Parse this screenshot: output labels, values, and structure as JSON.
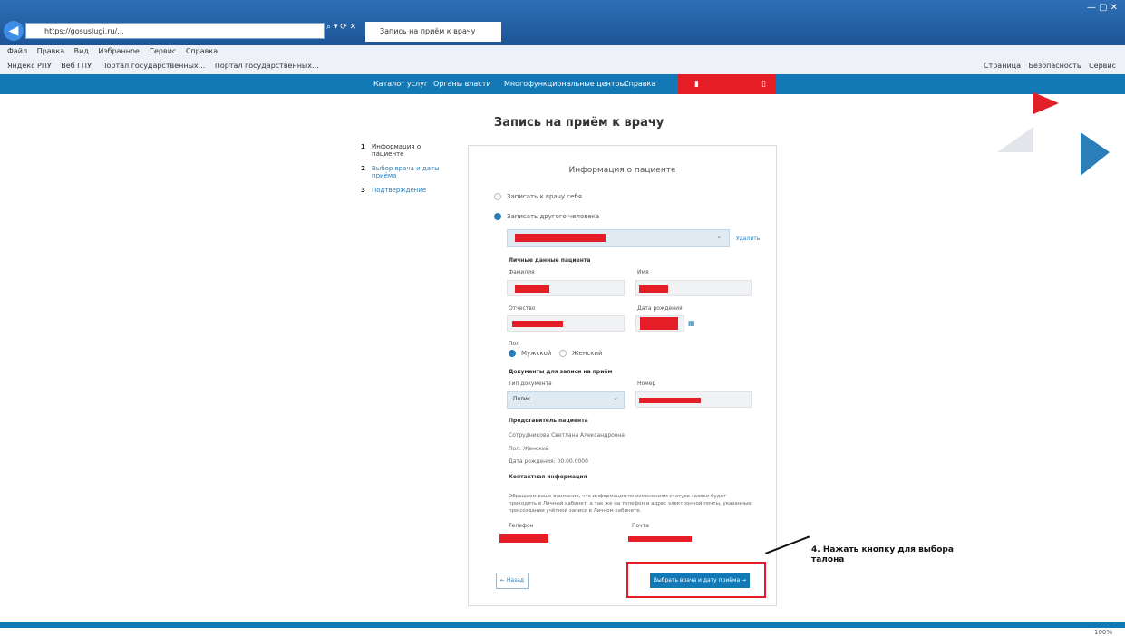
{
  "browser": {
    "address": "https://gosuslugi.ru/...",
    "tab_title": "Запись на приём к врачу",
    "menu": [
      "Файл",
      "Правка",
      "Вид",
      "Избранное",
      "Сервис",
      "Справка"
    ],
    "favorites": [
      "Яндекс РПУ",
      "Веб ГПУ",
      "Портал государственных...",
      "Портал государственных..."
    ],
    "toolbar_right": [
      "Страница",
      "Безопасность",
      "Сервис"
    ],
    "zoom": "100%"
  },
  "site_nav": {
    "items": [
      "Каталог услуг",
      "Органы власти",
      "Многофункциональные центры",
      "Справка"
    ]
  },
  "page": {
    "title": "Запись на приём к врачу"
  },
  "steps": [
    {
      "num": "1",
      "label": "Информация о пациенте"
    },
    {
      "num": "2",
      "label": "Выбор врача и даты приёма"
    },
    {
      "num": "3",
      "label": "Подтверждение"
    }
  ],
  "form": {
    "title": "Информация о пациенте",
    "option_self": "Записать к врачу себя",
    "option_other": "Записать другого человека",
    "delete_link": "Удалить",
    "patient_section": "Личные данные пациента",
    "lbl_surname": "Фамилия",
    "lbl_name": "Имя",
    "lbl_patronymic": "Отчество",
    "lbl_birthdate": "Дата рождения",
    "lbl_gender": "Пол",
    "gender_male": "Мужской",
    "gender_female": "Женский",
    "docs_section": "Документы для записи на приём",
    "lbl_policy_type": "Тип документа",
    "policy_value": "Полис",
    "lbl_number": "Номер",
    "rep_section": "Представитель пациента",
    "rep_name": "Сотрудникова Светлана Александровна",
    "rep_gender": "Пол: Женский",
    "rep_birthdate": "Дата рождения: 00.00.0000",
    "contact_section": "Контактная информация",
    "consent_text": "Обращаем ваше внимание, что информация по изменениям статуса заявки будет приходить в Личный кабинет, а так же на телефон и адрес электронной почты, указанные при создании учётной записи в Личном кабинете.",
    "lbl_phone": "Телефон",
    "lbl_email": "Почта",
    "back_button": "← Назад",
    "next_button": "Выбрать врача и дату приёма →"
  },
  "annotation": {
    "text": "4. Нажать кнопку для выбора талона"
  }
}
